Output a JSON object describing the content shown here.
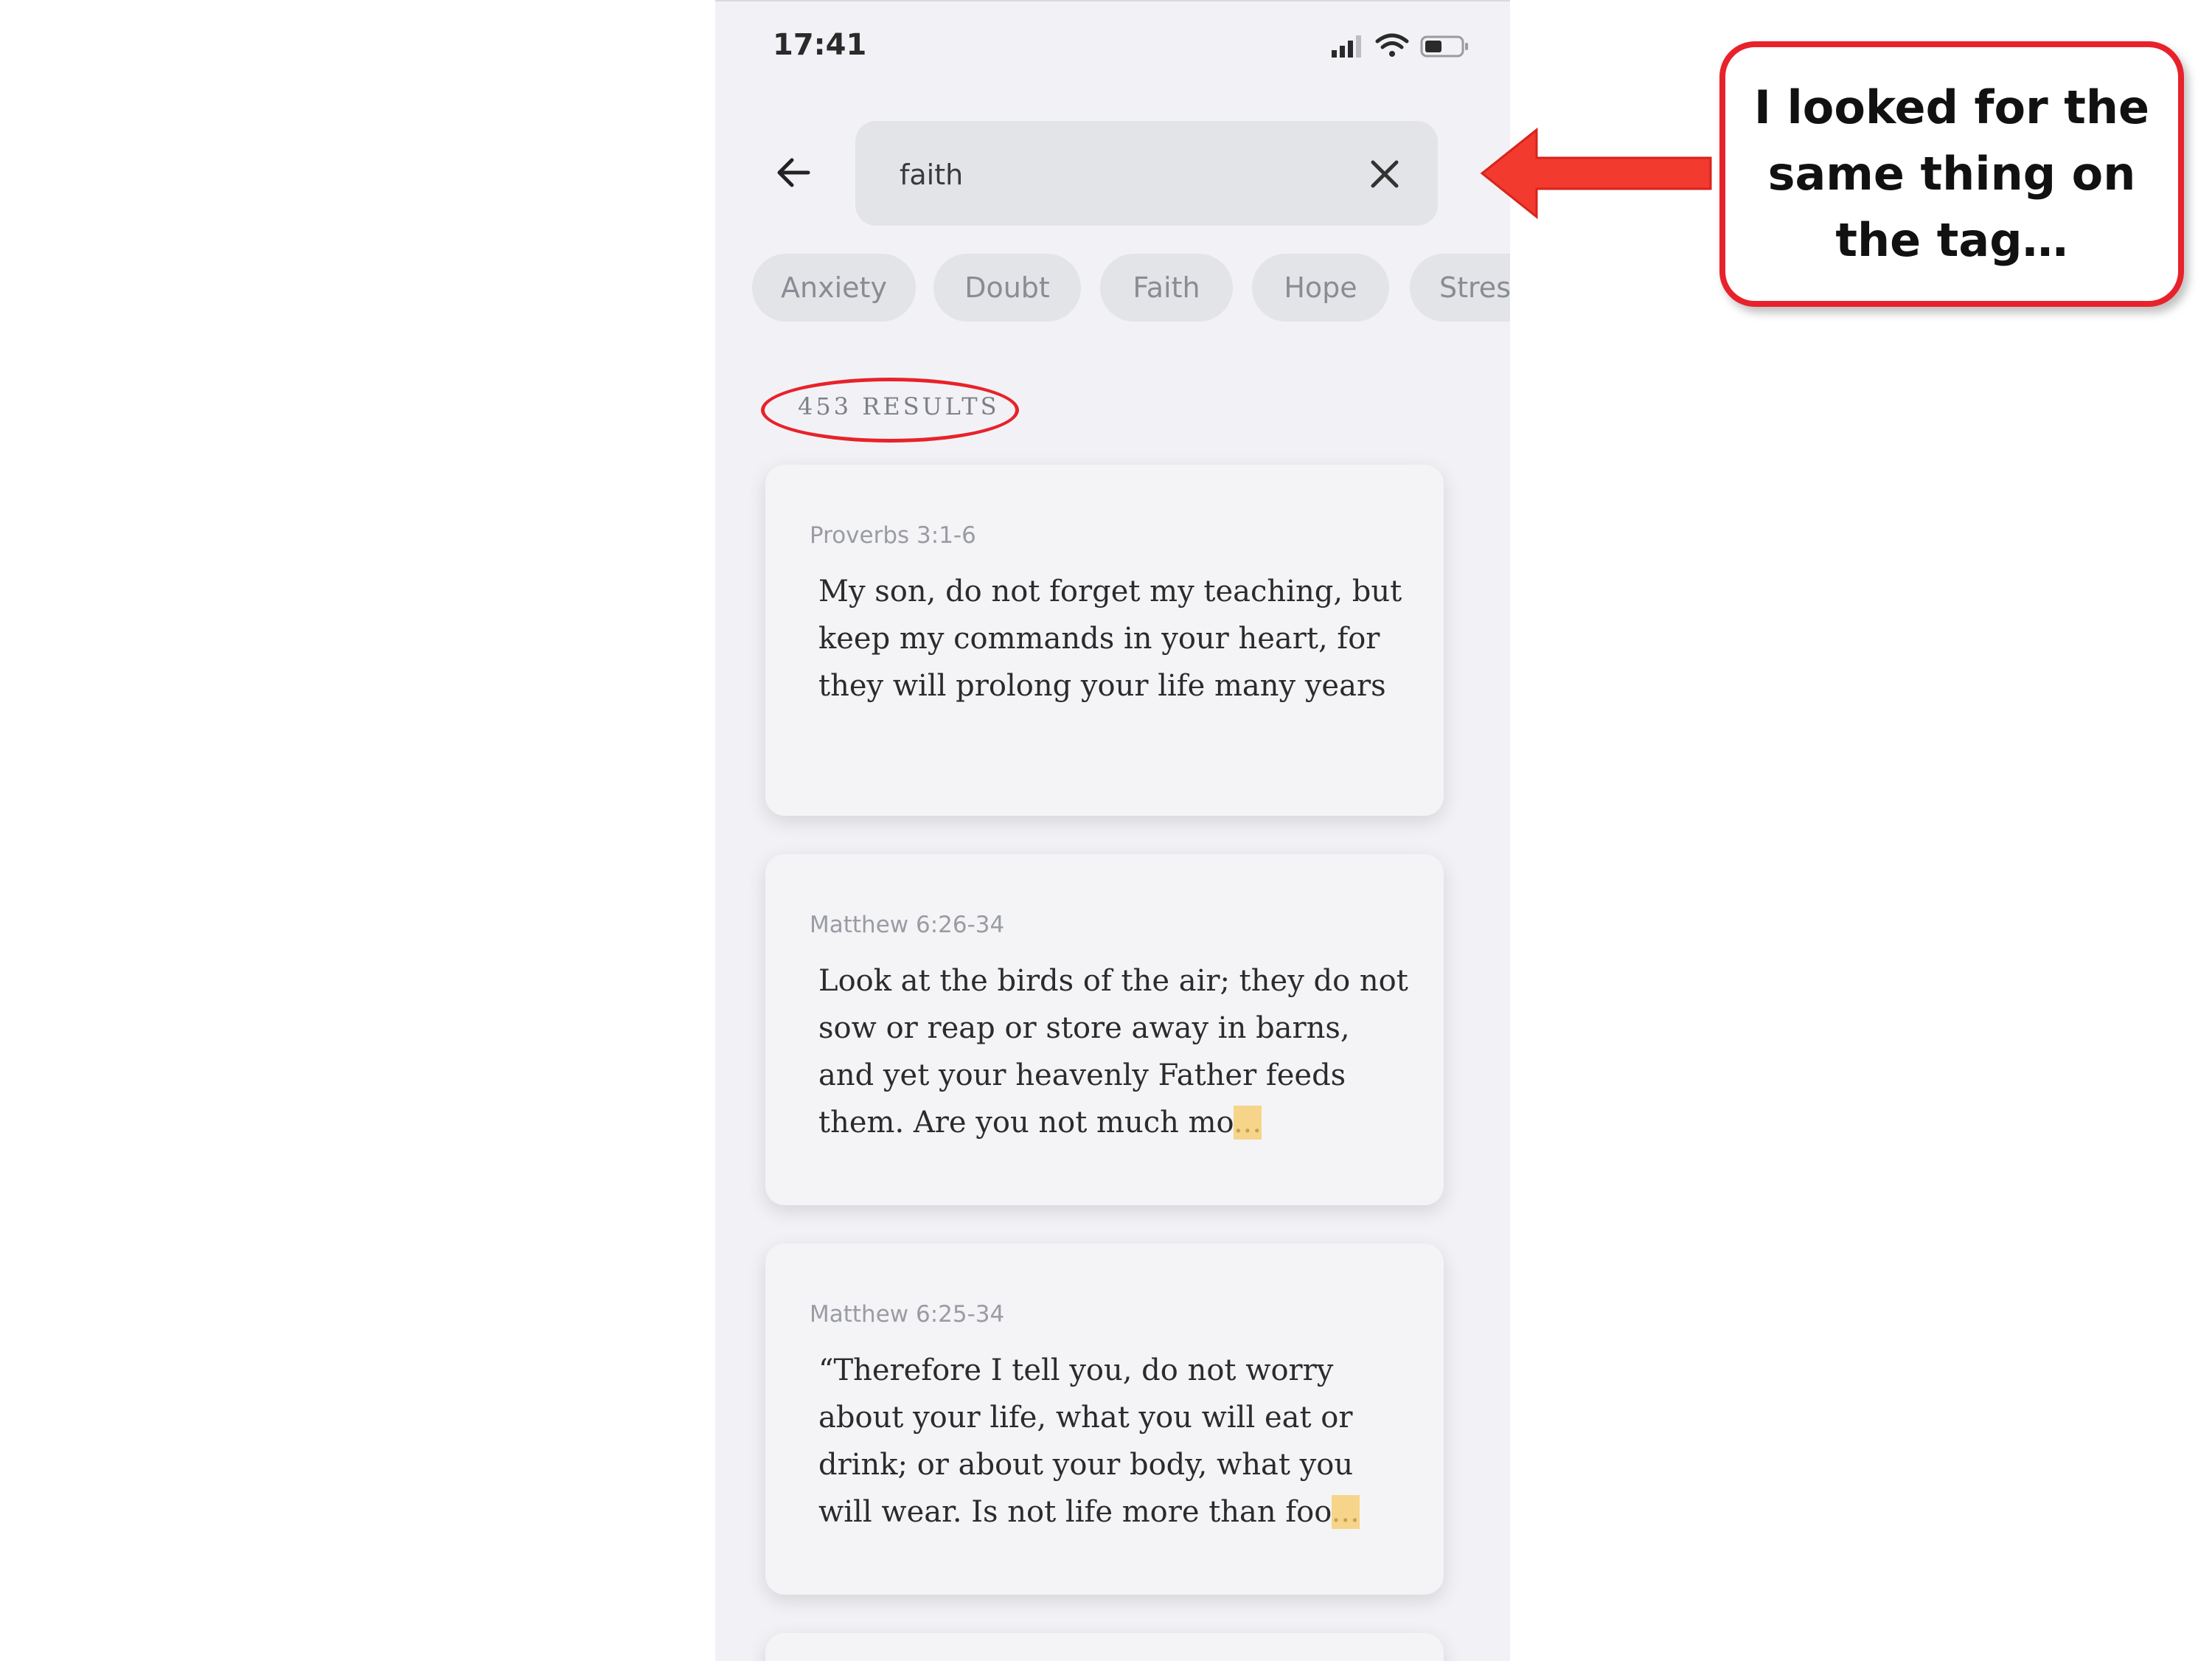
{
  "status_bar": {
    "time": "17:41"
  },
  "search": {
    "query": "faith",
    "back_icon": "arrow-left-icon",
    "clear_icon": "close-icon"
  },
  "chips": [
    "Anxiety",
    "Doubt",
    "Faith",
    "Hope",
    "Stres"
  ],
  "results": {
    "count_label": "453 RESULTS"
  },
  "cards": [
    {
      "reference": "Proverbs 3:1-6",
      "text": " My son, do not forget my teaching, but keep my commands in your heart, for they will prolong your life many years",
      "truncation": ""
    },
    {
      "reference": "Matthew 6:26-34",
      "text": " Look at the birds of the air; they do not sow or reap or store away in barns, and yet your heavenly Father feeds them. Are you not much mo",
      "truncation": "..."
    },
    {
      "reference": "Matthew 6:25-34",
      "text": " “Therefore I tell you, do not worry about your life, what you will eat or drink; or about your body, what you will wear. Is not life more than foo",
      "truncation": "..."
    }
  ],
  "annotation": {
    "callout_text": "I looked for the same thing on the tag…",
    "accent_color": "#e8222a"
  }
}
